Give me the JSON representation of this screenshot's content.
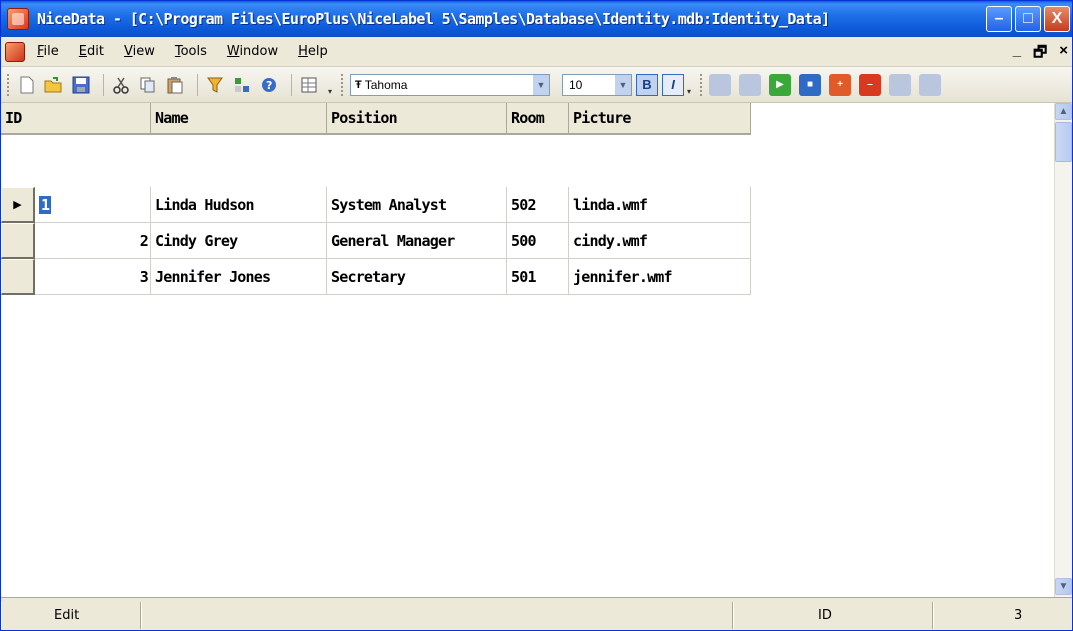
{
  "window": {
    "title": "NiceData - [C:\\Program Files\\EuroPlus\\NiceLabel 5\\Samples\\Database\\Identity.mdb:Identity_Data]",
    "minimize": "–",
    "maximize": "□",
    "close": "X"
  },
  "menu": {
    "items": [
      {
        "first": "F",
        "rest": "ile"
      },
      {
        "first": "E",
        "rest": "dit"
      },
      {
        "first": "V",
        "rest": "iew"
      },
      {
        "first": "T",
        "rest": "ools"
      },
      {
        "first": "W",
        "rest": "indow"
      },
      {
        "first": "H",
        "rest": "elp"
      }
    ],
    "mdi_min": "_",
    "mdi_restore": "🗗",
    "mdi_close": "×"
  },
  "toolbar": {
    "font_name": "Tahoma",
    "font_icon": "Ŧ",
    "font_size": "10",
    "bold": "B",
    "italic": "I",
    "icons": [
      "new-icon",
      "open-icon",
      "save-icon",
      "cut-icon",
      "copy-icon",
      "paste-icon",
      "filter-icon",
      "sort-icon",
      "help-icon",
      "table-icon"
    ]
  },
  "grid": {
    "columns": [
      "ID",
      "Name",
      "Position",
      "Room",
      "Picture"
    ],
    "rows": [
      {
        "id": "1",
        "name": "Linda Hudson",
        "position": "System Analyst",
        "room": "502",
        "picture": "linda.wmf"
      },
      {
        "id": "2",
        "name": "Cindy Grey",
        "position": "General Manager",
        "room": "500",
        "picture": "cindy.wmf"
      },
      {
        "id": "3",
        "name": "Jennifer Jones",
        "position": "Secretary",
        "room": "501",
        "picture": "jennifer.wmf"
      }
    ],
    "current_row_indicator": "▶"
  },
  "status": {
    "mode": "Edit",
    "field": "ID",
    "value": "3"
  },
  "colors": {
    "titlebar": "#0c58d8",
    "selection": "#316ac5",
    "chrome": "#ece9d8"
  }
}
